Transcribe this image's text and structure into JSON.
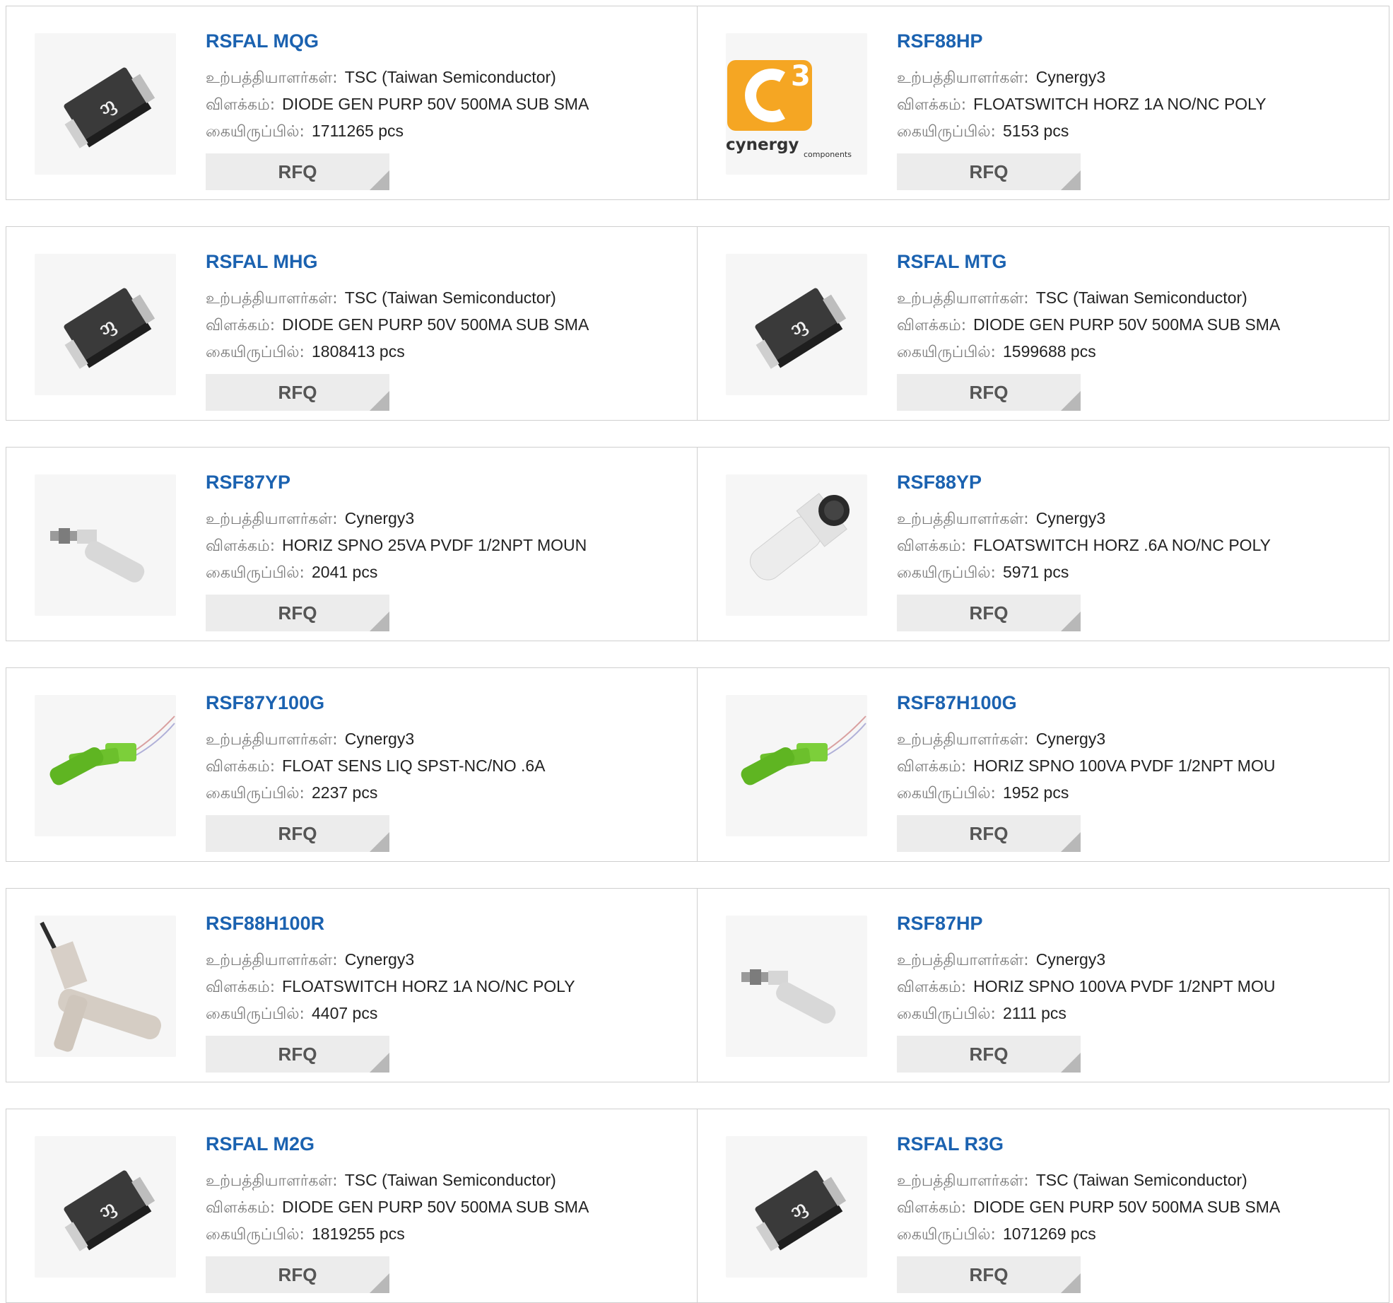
{
  "labels": {
    "manufacturer": "உற்பத்தியாளர்கள்:",
    "description": "விளக்கம்:",
    "stock": "கையிருப்பில்:"
  },
  "products": [
    {
      "part": "RSFAL MQG",
      "manufacturer": "TSC (Taiwan Semiconductor)",
      "description": "DIODE GEN PURP 50V 500MA SUB SMA",
      "stock": "1711265 pcs",
      "rfq": "RFQ",
      "image": "diode-chip-image"
    },
    {
      "part": "RSF88HP",
      "manufacturer": "Cynergy3",
      "description": "FLOATSWITCH HORZ 1A NO/NC POLY",
      "stock": "5153 pcs",
      "rfq": "RFQ",
      "image": "cynergy3-logo",
      "logo_text": "cynergy",
      "logo_sup": "3",
      "logo_sub": "components"
    },
    {
      "part": "RSFAL MHG",
      "manufacturer": "TSC (Taiwan Semiconductor)",
      "description": "DIODE GEN PURP 50V 500MA SUB SMA",
      "stock": "1808413 pcs",
      "rfq": "RFQ",
      "image": "diode-chip-image"
    },
    {
      "part": "RSFAL MTG",
      "manufacturer": "TSC (Taiwan Semiconductor)",
      "description": "DIODE GEN PURP 50V 500MA SUB SMA",
      "stock": "1599688 pcs",
      "rfq": "RFQ",
      "image": "diode-chip-image"
    },
    {
      "part": "RSF87YP",
      "manufacturer": "Cynergy3",
      "description": "HORIZ SPNO 25VA PVDF 1/2NPT MOUN",
      "stock": "2041 pcs",
      "rfq": "RFQ",
      "image": "float-switch-gray-image"
    },
    {
      "part": "RSF88YP",
      "manufacturer": "Cynergy3",
      "description": "FLOATSWITCH HORZ .6A NO/NC POLY",
      "stock": "5971 pcs",
      "rfq": "RFQ",
      "image": "float-switch-white-image"
    },
    {
      "part": "RSF87Y100G",
      "manufacturer": "Cynergy3",
      "description": "FLOAT SENS LIQ SPST-NC/NO .6A",
      "stock": "2237 pcs",
      "rfq": "RFQ",
      "image": "float-switch-green-image"
    },
    {
      "part": "RSF87H100G",
      "manufacturer": "Cynergy3",
      "description": "HORIZ SPNO 100VA PVDF 1/2NPT MOU",
      "stock": "1952 pcs",
      "rfq": "RFQ",
      "image": "float-switch-green-image"
    },
    {
      "part": "RSF88H100R",
      "manufacturer": "Cynergy3",
      "description": "FLOATSWITCH HORZ 1A NO/NC POLY",
      "stock": "4407 pcs",
      "rfq": "RFQ",
      "image": "float-switch-beige-image"
    },
    {
      "part": "RSF87HP",
      "manufacturer": "Cynergy3",
      "description": "HORIZ SPNO 100VA PVDF 1/2NPT MOU",
      "stock": "2111 pcs",
      "rfq": "RFQ",
      "image": "float-switch-gray-image"
    },
    {
      "part": "RSFAL M2G",
      "manufacturer": "TSC (Taiwan Semiconductor)",
      "description": "DIODE GEN PURP 50V 500MA SUB SMA",
      "stock": "1819255 pcs",
      "rfq": "RFQ",
      "image": "diode-chip-image"
    },
    {
      "part": "RSFAL R3G",
      "manufacturer": "TSC (Taiwan Semiconductor)",
      "description": "DIODE GEN PURP 50V 500MA SUB SMA",
      "stock": "1071269 pcs",
      "rfq": "RFQ",
      "image": "diode-chip-image"
    }
  ],
  "colors": {
    "part_link": "#1b62b0",
    "label": "#7a7a7a",
    "rfq_bg": "#ececec",
    "logo_orange": "#f5a623"
  }
}
